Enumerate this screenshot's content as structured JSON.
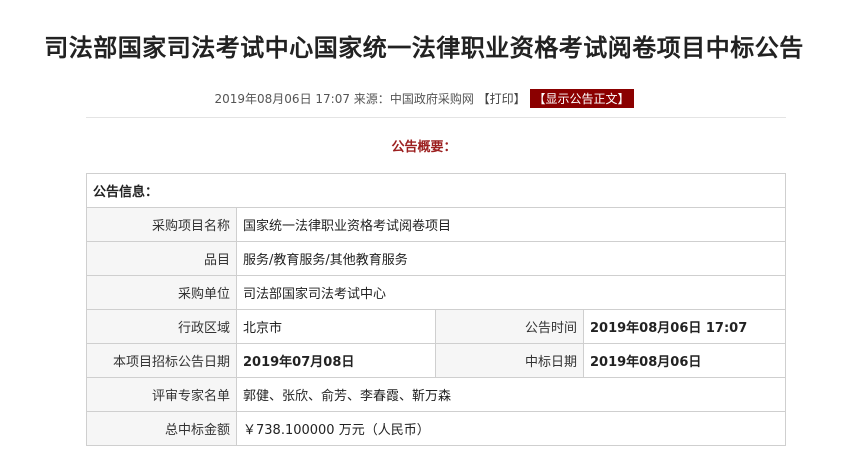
{
  "title": "司法部国家司法考试中心国家统一法律职业资格考试阅卷项目中标公告",
  "meta": {
    "datetime": "2019年08月06日 17:07",
    "source_label": "来源：",
    "source": "中国政府采购网",
    "print": "【打印】",
    "show_full": "【显示公告正文】"
  },
  "overview": "公告概要：",
  "info": {
    "header": "公告信息：",
    "project_name_label": "采购项目名称",
    "project_name": "国家统一法律职业资格考试阅卷项目",
    "category_label": "品目",
    "category": "服务/教育服务/其他教育服务",
    "purchaser_label": "采购单位",
    "purchaser": "司法部国家司法考试中心",
    "region_label": "行政区域",
    "region": "北京市",
    "notice_time_label": "公告时间",
    "notice_time": "2019年08月06日  17:07",
    "tender_date_label": "本项目招标公告日期",
    "tender_date": "2019年07月08日",
    "award_date_label": "中标日期",
    "award_date": "2019年08月06日",
    "experts_label": "评审专家名单",
    "experts": "郭健、张欣、俞芳、李春霞、靳万森",
    "amount_label": "总中标金额",
    "amount": "￥738.100000 万元（人民币）"
  }
}
